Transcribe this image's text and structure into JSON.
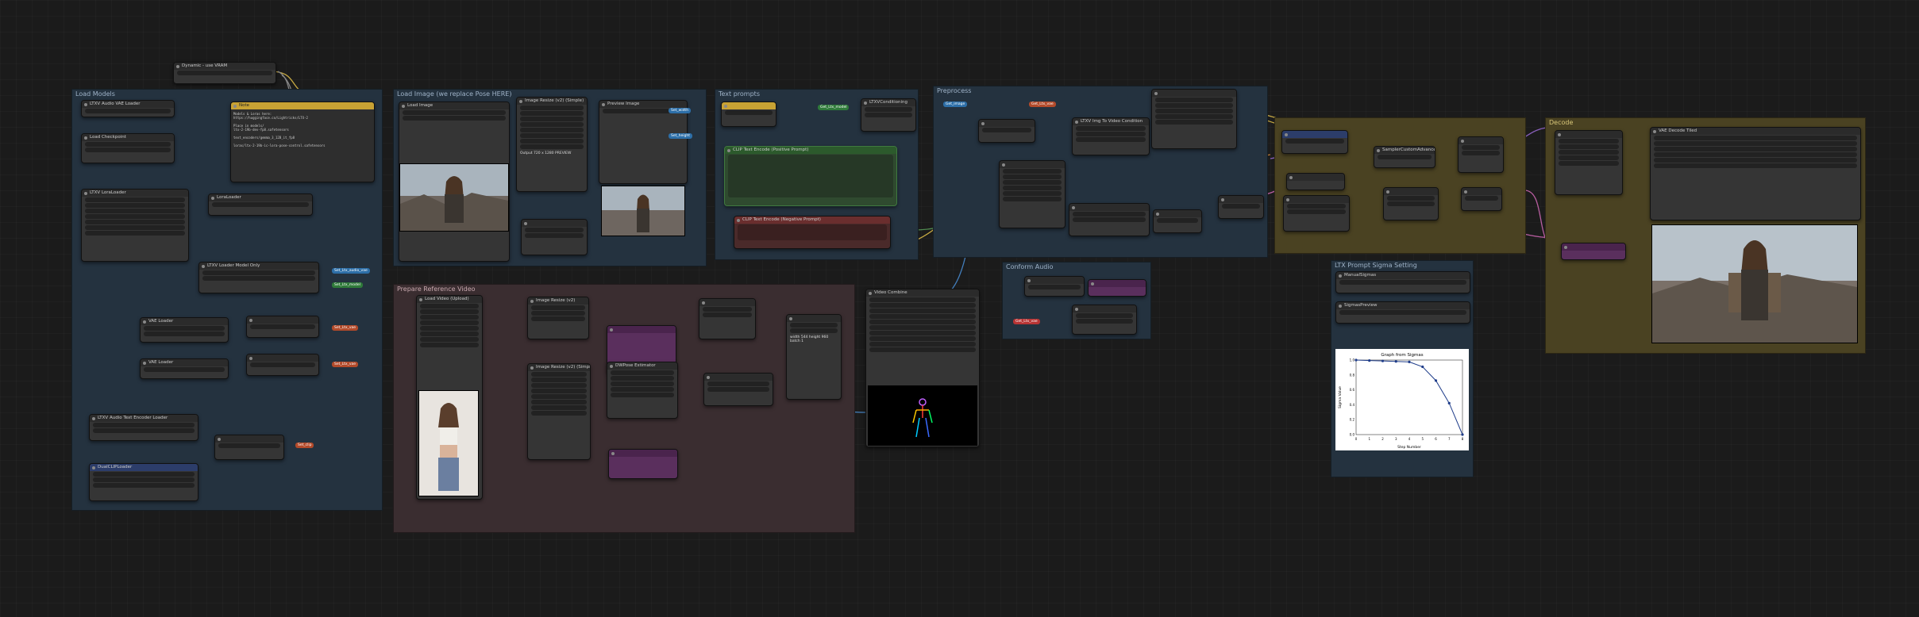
{
  "groups": {
    "load_models": "Load Models",
    "load_image": "Load Image (we replace Pose HERE)",
    "text_prompts": "Text prompts",
    "preprocess": "Preprocess",
    "prepare_video": "Prepare Reference Video",
    "conform_audio": "Conform Audio",
    "ltx_sigma": "LTX Prompt Sigma Setting",
    "decode": "Decode"
  },
  "nodes": {
    "dynamic_vram": "Dynamic - use VRAM",
    "ltxv_audio_vae": "LTXV Audio VAE Loader",
    "load_checkpoint": "Load Checkpoint",
    "lora_loader": "LTXV LoraLoader",
    "lora_loader_2": "LoraLoader",
    "ltxv_loader": "LTXV Loader Model Only",
    "vae_loader": "VAE Loader",
    "clip_loader": "LTXV Audio Text Encoder Loader",
    "dual_clip": "DualCLIPLoader",
    "note": "Note",
    "load_image": "Load Image",
    "image_resize": "Image Resize (v2) (Simple)",
    "preview_image": "Preview Image",
    "clip_pos": "CLIP Text Encode (Positive Prompt)",
    "clip_neg": "CLIP Text Encode (Negative Prompt)",
    "ltxv_conditioning": "LTXVConditioning",
    "ltxv_img_to_video": "LTXV Img To Video Condition",
    "load_video": "Load Video (Upload)",
    "image_resize_2": "Image Resize (v2)",
    "dwpose": "DWPose Estimator",
    "video_combine": "Video Combine",
    "sampler_custom": "SamplerCustomAdvanced",
    "manual_sigmas": "ManualSigmas",
    "sigmas_preview": "SigmasPreview",
    "vae_decode": "VAE Decode Tiled",
    "preview_decode": "Preview Image"
  },
  "note_text": [
    "Models & Loras here:",
    "https://huggingface.co/Lightricks/LTX-2",
    "",
    "Place in models/",
    "ltx-2-19b-dev-fp8.safetensors",
    "",
    "text_encoders/gemma_3_12B_it_fp8",
    "",
    "loras/ltx-2-19b-ic-lora-pose-control.safetensors"
  ],
  "image_labels": {
    "output_size": "Output 720 x 1280 PREVIEW",
    "video_meta": "width 544 height 960 batch 1"
  },
  "chart_data": {
    "type": "line",
    "title": "Graph from Sigmas",
    "xlabel": "Step Number",
    "ylabel": "Sigma Value",
    "x": [
      0,
      1,
      2,
      3,
      4,
      5,
      6,
      7,
      8
    ],
    "values": [
      1.0,
      0.99375,
      0.9875,
      0.98125,
      0.975,
      0.909375,
      0.725,
      0.421875,
      0.0
    ],
    "ylim": [
      0,
      1
    ],
    "grid": false
  },
  "colors": {
    "link_blue": "#4a90d9",
    "link_yellow": "#e6c34a",
    "link_pink": "#d46ab8",
    "link_purple": "#9a6ad4",
    "link_orange": "#d68a3a",
    "link_green": "#5aa05a",
    "link_red": "#c84a4a"
  },
  "badges": {
    "set_audio_vae": "Set_Ltx_audio_vae",
    "set_model": "Set_Ltx_model",
    "set_vae": "Set_Ltx_vae",
    "set_clip": "Set_clip",
    "get_model": "Get_Ltx_model",
    "get_vae": "Get_Ltx_vae",
    "set_width": "Set_width",
    "set_height": "Set_height",
    "get_image": "Get_image"
  }
}
